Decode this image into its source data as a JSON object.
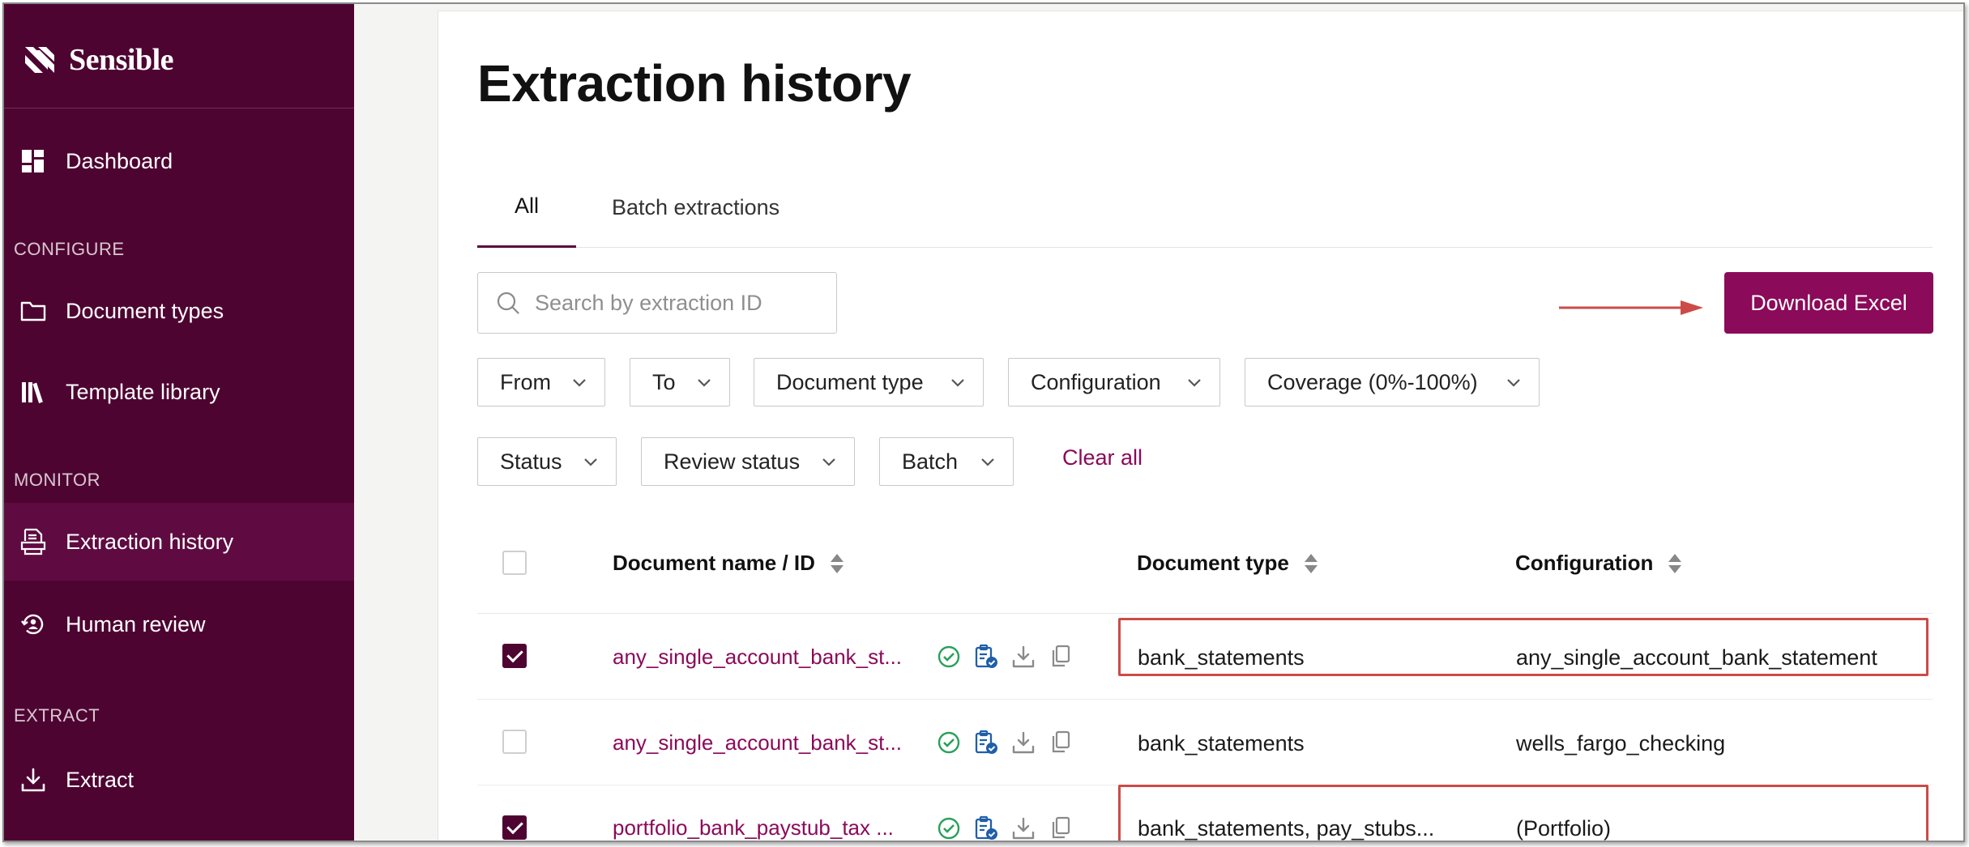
{
  "brand": {
    "name": "Sensible"
  },
  "sidebar": {
    "items": [
      {
        "label": "Dashboard",
        "icon": "dashboard-icon"
      },
      {
        "label": "Document types",
        "icon": "folder-icon"
      },
      {
        "label": "Template library",
        "icon": "library-icon"
      },
      {
        "label": "Extraction history",
        "icon": "extraction-history-icon",
        "active": true
      },
      {
        "label": "Human review",
        "icon": "human-review-icon"
      },
      {
        "label": "Extract",
        "icon": "download-icon"
      }
    ],
    "sections": {
      "configure": "CONFIGURE",
      "monitor": "MONITOR",
      "extract": "EXTRACT"
    }
  },
  "page": {
    "title": "Extraction history"
  },
  "tabs": [
    {
      "label": "All",
      "active": true
    },
    {
      "label": "Batch extractions",
      "active": false
    }
  ],
  "search": {
    "placeholder": "Search by extraction ID",
    "value": ""
  },
  "download_button": {
    "label": "Download Excel"
  },
  "filters": {
    "from": "From",
    "to": "To",
    "document_type": "Document type",
    "configuration": "Configuration",
    "coverage": "Coverage (0%-100%)",
    "status": "Status",
    "review_status": "Review status",
    "batch": "Batch",
    "clear_all": "Clear all"
  },
  "table": {
    "columns": {
      "document_name": "Document name / ID",
      "document_type": "Document type",
      "configuration": "Configuration"
    },
    "rows": [
      {
        "checked": true,
        "document_name": "any_single_account_bank_st...",
        "document_type": "bank_statements",
        "configuration": "any_single_account_bank_statement"
      },
      {
        "checked": false,
        "document_name": "any_single_account_bank_st...",
        "document_type": "bank_statements",
        "configuration": "wells_fargo_checking"
      },
      {
        "checked": true,
        "document_name": "portfolio_bank_paystub_tax ...",
        "document_type": "bank_statements, pay_stubs...",
        "configuration": "(Portfolio)"
      }
    ]
  },
  "colors": {
    "sidebar_bg": "#4e0431",
    "sidebar_active": "#5f0b42",
    "primary_button": "#8b0a5a",
    "link": "#8b0a5a",
    "status_ok": "#2aa05a",
    "review_icon": "#1f5fa8",
    "annotation": "#cc4b47"
  }
}
